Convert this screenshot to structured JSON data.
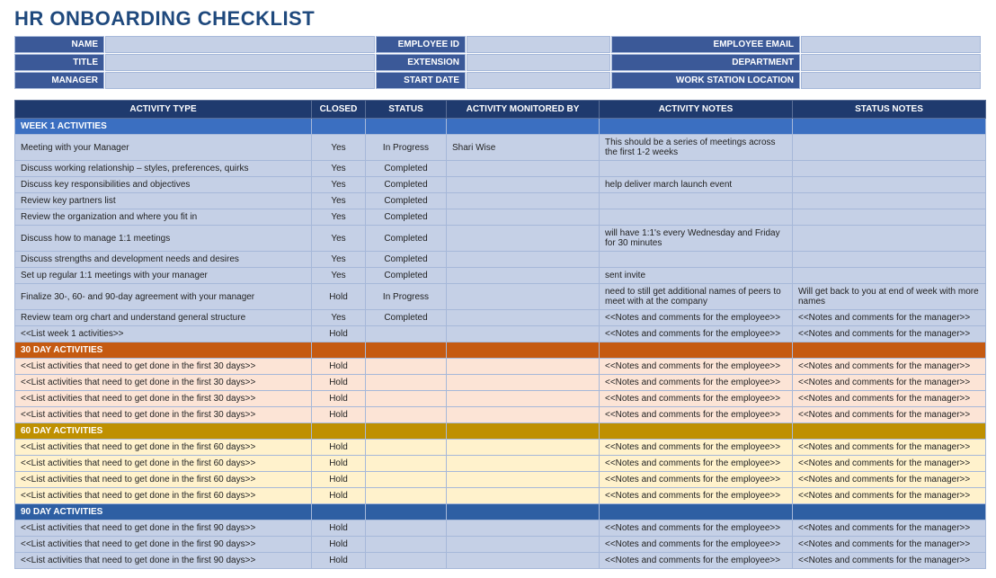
{
  "title": "HR ONBOARDING CHECKLIST",
  "info": {
    "labels": {
      "name": "NAME",
      "employee_id": "EMPLOYEE ID",
      "employee_email": "EMPLOYEE EMAIL",
      "title": "TITLE",
      "extension": "EXTENSION",
      "department": "DEPARTMENT",
      "manager": "MANAGER",
      "start_date": "START DATE",
      "work_station": "WORK STATION LOCATION"
    },
    "values": {
      "name": "",
      "employee_id": "",
      "employee_email": "",
      "title": "",
      "extension": "",
      "department": "",
      "manager": "",
      "start_date": "",
      "work_station": ""
    }
  },
  "columns": {
    "activity_type": "ACTIVITY TYPE",
    "closed": "CLOSED",
    "status": "STATUS",
    "monitored_by": "ACTIVITY MONITORED BY",
    "activity_notes": "ACTIVITY NOTES",
    "status_notes": "STATUS NOTES"
  },
  "sections": [
    {
      "key": "week1",
      "header": "WEEK 1 ACTIVITIES",
      "row_class": "row-week1",
      "section_class": "section-week1",
      "rows": [
        {
          "activity": "Meeting with your Manager",
          "closed": "Yes",
          "status": "In Progress",
          "monitor": "Shari Wise",
          "act_notes": "This should be a series of meetings across the first 1-2 weeks",
          "stat_notes": ""
        },
        {
          "activity": "Discuss working relationship – styles, preferences, quirks",
          "closed": "Yes",
          "status": "Completed",
          "monitor": "",
          "act_notes": "",
          "stat_notes": ""
        },
        {
          "activity": "Discuss key responsibilities and objectives",
          "closed": "Yes",
          "status": "Completed",
          "monitor": "",
          "act_notes": "help deliver march launch event",
          "stat_notes": ""
        },
        {
          "activity": "Review key partners list",
          "closed": "Yes",
          "status": "Completed",
          "monitor": "",
          "act_notes": "",
          "stat_notes": ""
        },
        {
          "activity": "Review the organization and where you fit in",
          "closed": "Yes",
          "status": "Completed",
          "monitor": "",
          "act_notes": "",
          "stat_notes": ""
        },
        {
          "activity": "Discuss how to manage 1:1 meetings",
          "closed": "Yes",
          "status": "Completed",
          "monitor": "",
          "act_notes": "will have 1:1's every Wednesday and Friday for 30 minutes",
          "stat_notes": ""
        },
        {
          "activity": "Discuss strengths and development needs and desires",
          "closed": "Yes",
          "status": "Completed",
          "monitor": "",
          "act_notes": "",
          "stat_notes": ""
        },
        {
          "activity": "Set up regular 1:1 meetings with your manager",
          "closed": "Yes",
          "status": "Completed",
          "monitor": "",
          "act_notes": "sent invite",
          "stat_notes": ""
        },
        {
          "activity": "Finalize 30-, 60- and 90-day agreement with your manager",
          "closed": "Hold",
          "status": "In Progress",
          "monitor": "",
          "act_notes": "need to still get additional names of peers to meet with at the company",
          "stat_notes": "Will get back to you at end of week with more names"
        },
        {
          "activity": "Review team org chart and understand general structure",
          "closed": "Yes",
          "status": "Completed",
          "monitor": "",
          "act_notes": "<<Notes and comments for the employee>>",
          "stat_notes": "<<Notes and comments for the manager>>"
        },
        {
          "activity": "<<List week 1 activities>>",
          "closed": "Hold",
          "status": "",
          "monitor": "",
          "act_notes": "<<Notes and comments for the employee>>",
          "stat_notes": "<<Notes and comments for the manager>>"
        }
      ]
    },
    {
      "key": "30",
      "header": "30 DAY ACTIVITIES",
      "row_class": "row-30",
      "section_class": "section-30",
      "rows": [
        {
          "activity": "<<List activities that need to get done in the first 30 days>>",
          "closed": "Hold",
          "status": "",
          "monitor": "",
          "act_notes": "<<Notes and comments for the employee>>",
          "stat_notes": "<<Notes and comments for the manager>>"
        },
        {
          "activity": "<<List activities that need to get done in the first 30 days>>",
          "closed": "Hold",
          "status": "",
          "monitor": "",
          "act_notes": "<<Notes and comments for the employee>>",
          "stat_notes": "<<Notes and comments for the manager>>"
        },
        {
          "activity": "<<List activities that need to get done in the first 30 days>>",
          "closed": "Hold",
          "status": "",
          "monitor": "",
          "act_notes": "<<Notes and comments for the employee>>",
          "stat_notes": "<<Notes and comments for the manager>>"
        },
        {
          "activity": "<<List activities that need to get done in the first 30 days>>",
          "closed": "Hold",
          "status": "",
          "monitor": "",
          "act_notes": "<<Notes and comments for the employee>>",
          "stat_notes": "<<Notes and comments for the manager>>"
        }
      ]
    },
    {
      "key": "60",
      "header": "60 DAY ACTIVITIES",
      "row_class": "row-60",
      "section_class": "section-60",
      "rows": [
        {
          "activity": "<<List activities that need to get done in the first 60 days>>",
          "closed": "Hold",
          "status": "",
          "monitor": "",
          "act_notes": "<<Notes and comments for the employee>>",
          "stat_notes": "<<Notes and comments for the manager>>"
        },
        {
          "activity": "<<List activities that need to get done in the first 60 days>>",
          "closed": "Hold",
          "status": "",
          "monitor": "",
          "act_notes": "<<Notes and comments for the employee>>",
          "stat_notes": "<<Notes and comments for the manager>>"
        },
        {
          "activity": "<<List activities that need to get done in the first 60 days>>",
          "closed": "Hold",
          "status": "",
          "monitor": "",
          "act_notes": "<<Notes and comments for the employee>>",
          "stat_notes": "<<Notes and comments for the manager>>"
        },
        {
          "activity": "<<List activities that need to get done in the first 60 days>>",
          "closed": "Hold",
          "status": "",
          "monitor": "",
          "act_notes": "<<Notes and comments for the employee>>",
          "stat_notes": "<<Notes and comments for the manager>>"
        }
      ]
    },
    {
      "key": "90",
      "header": "90 DAY ACTIVITIES",
      "row_class": "row-90",
      "section_class": "section-90",
      "rows": [
        {
          "activity": "<<List activities that need to get done in the first 90 days>>",
          "closed": "Hold",
          "status": "",
          "monitor": "",
          "act_notes": "<<Notes and comments for the employee>>",
          "stat_notes": "<<Notes and comments for the manager>>"
        },
        {
          "activity": "<<List activities that need to get done in the first 90 days>>",
          "closed": "Hold",
          "status": "",
          "monitor": "",
          "act_notes": "<<Notes and comments for the employee>>",
          "stat_notes": "<<Notes and comments for the manager>>"
        },
        {
          "activity": "<<List activities that need to get done in the first 90 days>>",
          "closed": "Hold",
          "status": "",
          "monitor": "",
          "act_notes": "<<Notes and comments for the employee>>",
          "stat_notes": "<<Notes and comments for the manager>>"
        }
      ]
    }
  ]
}
